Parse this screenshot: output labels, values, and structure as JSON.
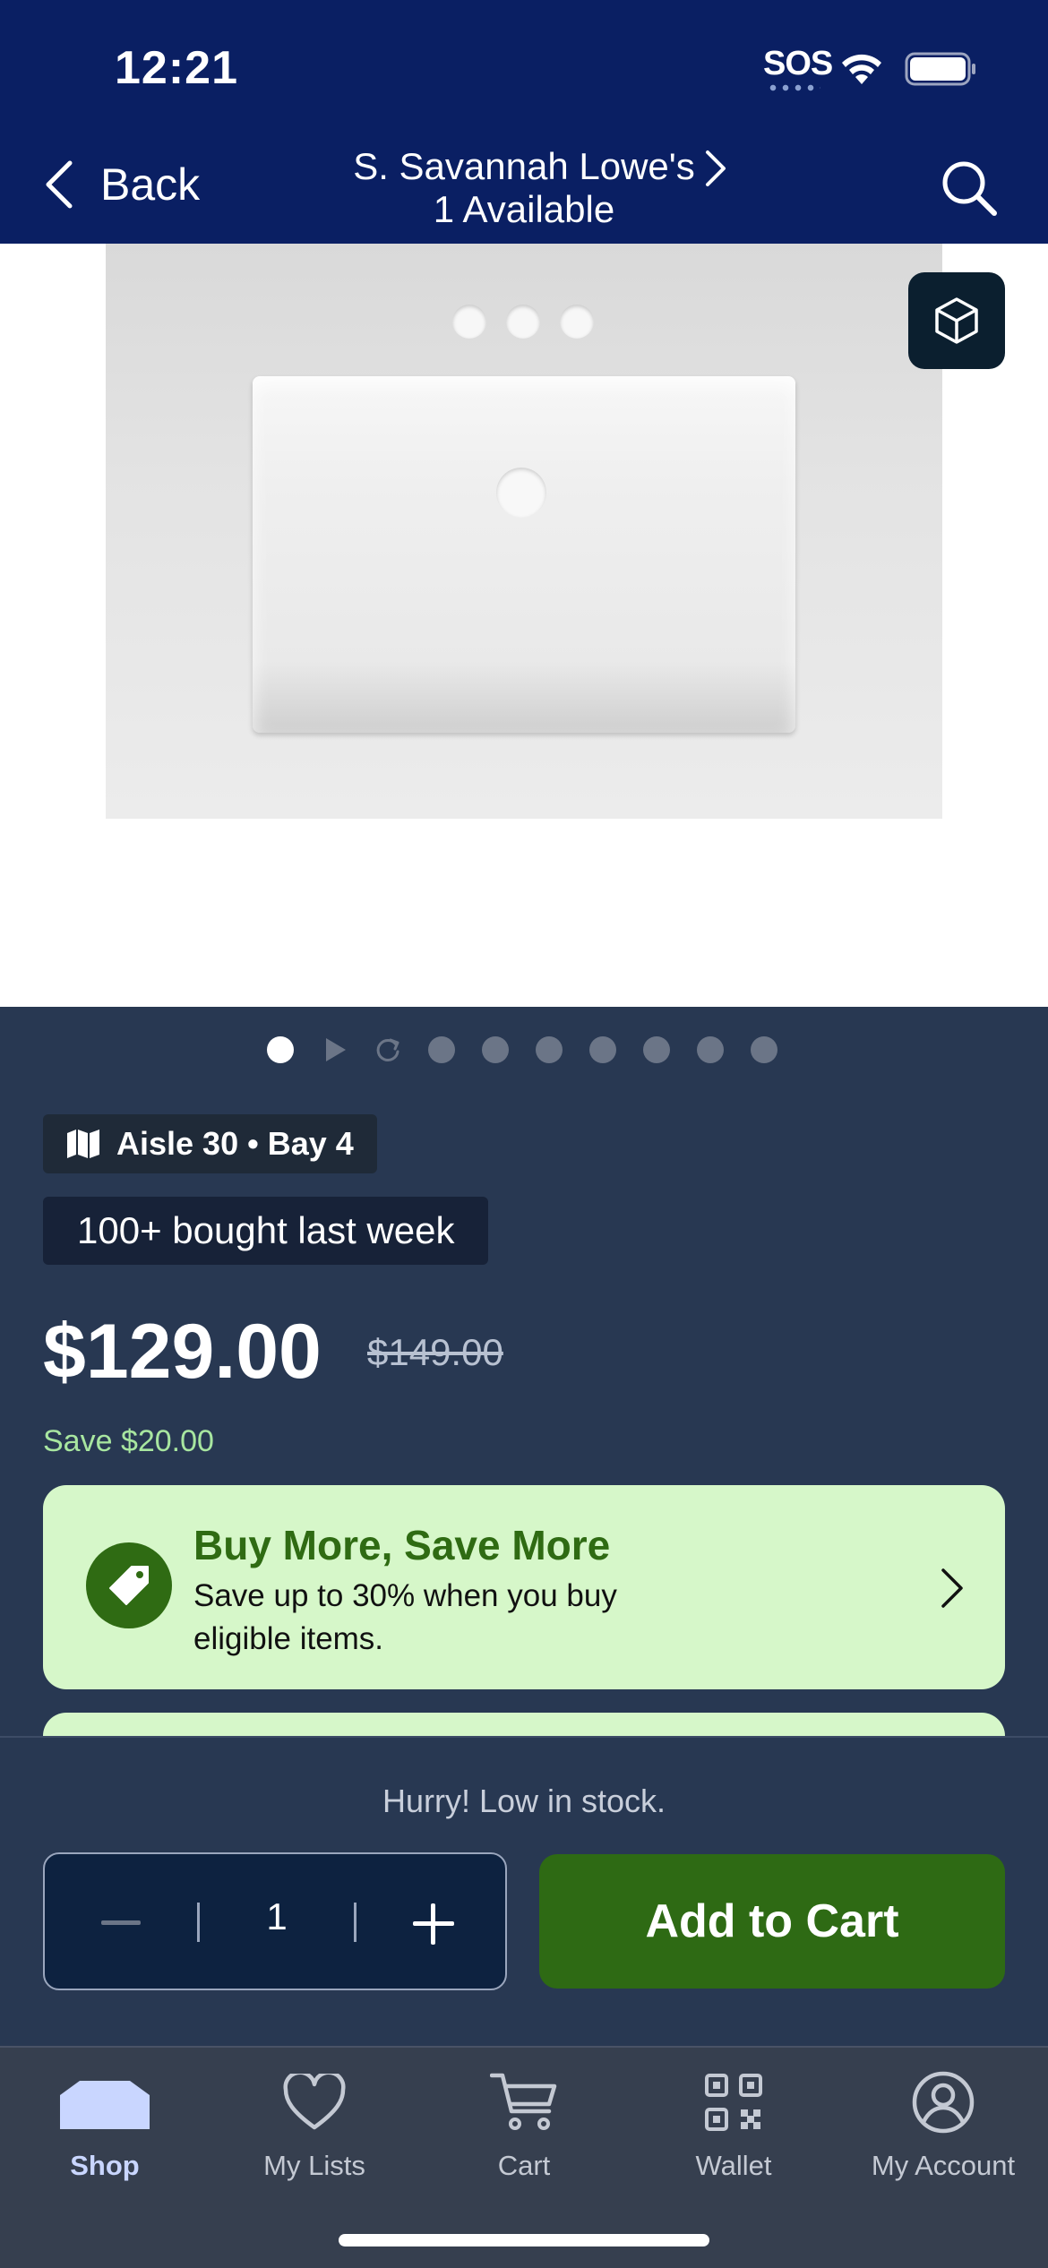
{
  "status_bar": {
    "time": "12:21",
    "sos": "SOS"
  },
  "nav": {
    "back_label": "Back",
    "store_name": "S. Savannah Lowe's",
    "availability": "1 Available"
  },
  "gallery": {
    "total_items": 10,
    "active_index": 0
  },
  "location": {
    "aisle_bay": "Aisle 30 • Bay 4"
  },
  "social_proof": "100+ bought last week",
  "pricing": {
    "price": "$129.00",
    "was_price": "$149.00",
    "savings": "Save $20.00"
  },
  "promo": {
    "title": "Buy More, Save More",
    "subtitle": "Save up to 30% when you buy eligible items."
  },
  "stock_message": "Hurry! Low in stock.",
  "quantity": {
    "value": "1"
  },
  "add_to_cart_label": "Add to Cart",
  "tabs": [
    {
      "label": "Shop",
      "icon": "shop-icon",
      "active": true
    },
    {
      "label": "My Lists",
      "icon": "heart-icon",
      "active": false
    },
    {
      "label": "Cart",
      "icon": "cart-icon",
      "active": false
    },
    {
      "label": "Wallet",
      "icon": "qr-code-icon",
      "active": false
    },
    {
      "label": "My Account",
      "icon": "account-icon",
      "active": false
    }
  ],
  "colors": {
    "header": "#0a1f63",
    "body": "#283852",
    "accent_green": "#2e6a14",
    "promo_bg": "#d6f7c9",
    "savings_green": "#a8e6a0"
  }
}
